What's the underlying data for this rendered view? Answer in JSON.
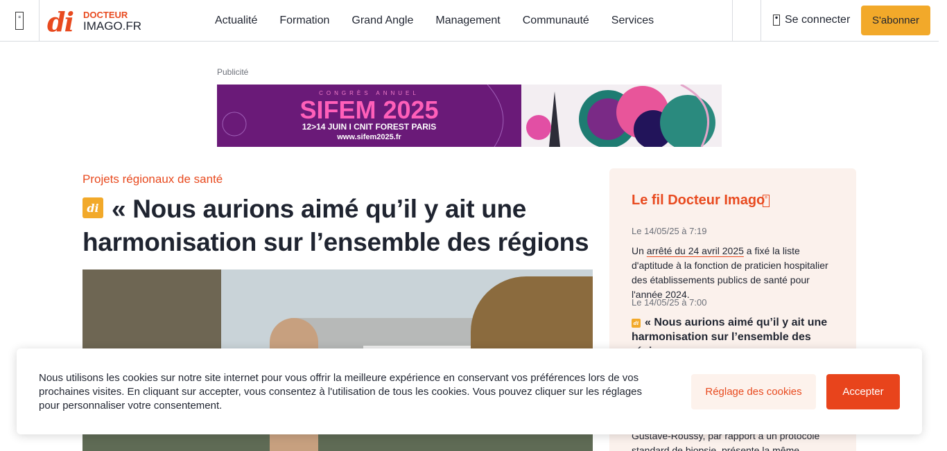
{
  "header": {
    "menu_icon": "menu-icon",
    "logo": {
      "mark": "di",
      "line1": "DOCTEUR",
      "line2": "IMAGO.FR"
    },
    "nav": [
      "Actualité",
      "Formation",
      "Grand Angle",
      "Management",
      "Communauté",
      "Services"
    ],
    "login_label": "Se connecter",
    "login_icon": "user-icon",
    "subscribe_label": "S'abonner"
  },
  "ad": {
    "label": "Publicité",
    "kicker": "CONGRÈS ANNUEL",
    "title": "SIFEM 2025",
    "dates": "12>14 JUIN I CNIT FOREST PARIS",
    "url": "www.sifem2025.fr"
  },
  "article": {
    "category": "Projets régionaux de santé",
    "badge": "di",
    "title": "« Nous aurions aimé qu’il y ait une harmonisation sur l’ensemble des régions »"
  },
  "sidebar": {
    "title": "Le fil Docteur Imago",
    "title_icon": "feed-icon",
    "items": [
      {
        "date": "Le 14/05/25 à 7:19",
        "body_prefix": "Un ",
        "body_link": "arrêté du 24 avril 2025",
        "body_suffix": " a fixé la liste d'aptitude à la fonction de praticien hospitalier des établissements publics de santé pour l'année 2024."
      },
      {
        "date": "Le 14/05/25 à 7:00",
        "headline": "« Nous aurions aimé qu’il y ait une harmonisation sur l’ensemble des régions »"
      }
    ],
    "partial_text": "Gustave-Roussy, par rapport à un protocole standard de biopsie, présente la même proportion"
  },
  "cookie": {
    "text": "Nous utilisons les cookies sur notre site internet pour vous offrir la meilleure expérience en conservant vos préférences lors de vos prochaines visites. En cliquant sur accepter, vous consentez à l'utilisation de tous les cookies. Vous pouvez cliquer sur les réglages pour personnaliser votre consentement.",
    "settings_label": "Réglage des cookies",
    "accept_label": "Accepter"
  },
  "colors": {
    "brand_orange": "#e84a1f",
    "accent_yellow": "#f2a92a",
    "sidebar_bg": "#fbf1ec"
  }
}
